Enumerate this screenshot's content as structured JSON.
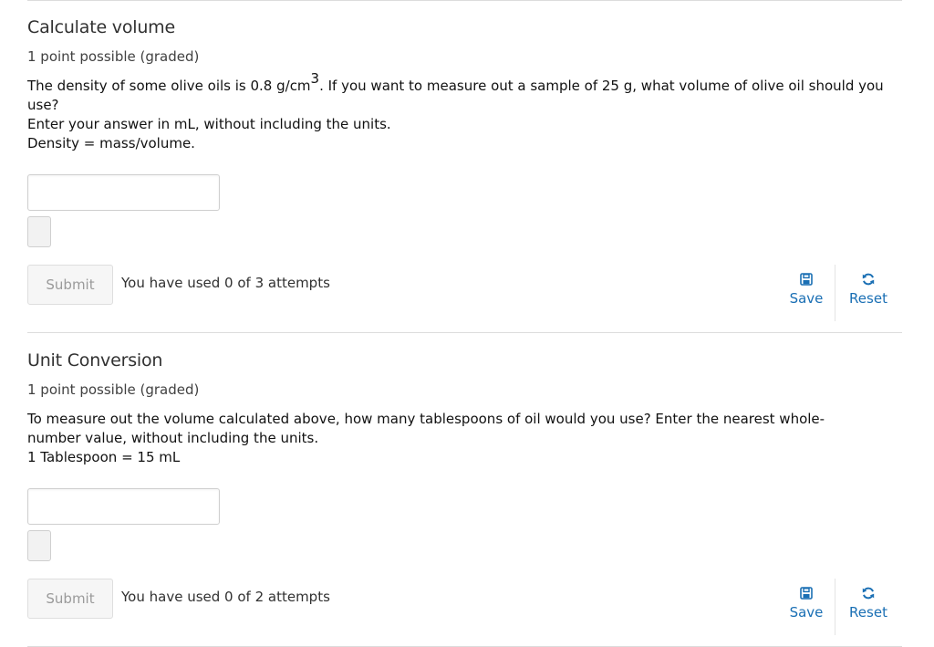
{
  "problems": [
    {
      "title": "Calculate volume",
      "points": "1 point possible (graded)",
      "prompt_line1_before_sup": "The density of some olive oils is 0.8 g/cm",
      "prompt_line1_sup": "3",
      "prompt_line1_after_sup": ". If you want to measure out a sample of 25 g, what volume of olive oil should you use?",
      "prompt_line2": "Enter your answer in mL, without including the units.",
      "prompt_line3": "Density = mass/volume.",
      "answer_value": "",
      "submit_label": "Submit",
      "attempts_text": "You have used 0 of 3 attempts",
      "save_label": "Save",
      "reset_label": "Reset"
    },
    {
      "title": "Unit Conversion",
      "points": "1 point possible (graded)",
      "prompt_line1": "To measure out the volume calculated above, how many tablespoons of oil would you use? Enter the nearest whole-number value, without including the units.",
      "prompt_line2": "1 Tablespoon = 15 mL",
      "answer_value": "",
      "submit_label": "Submit",
      "attempts_text": "You have used 0 of 2 attempts",
      "save_label": "Save",
      "reset_label": "Reset"
    }
  ],
  "colors": {
    "link": "#1a6fb4",
    "text": "#313131",
    "divider": "#dcdcdc",
    "disabled_text": "#9a9a9a"
  },
  "icons": {
    "save": "floppy-disk-icon",
    "reset": "refresh-icon"
  }
}
